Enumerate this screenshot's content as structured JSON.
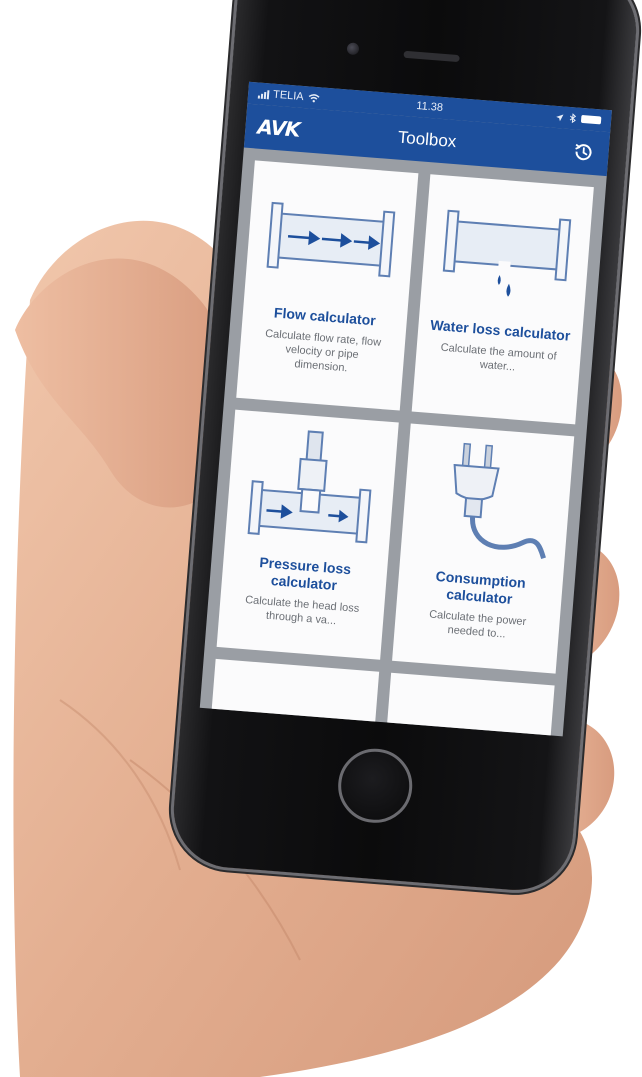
{
  "status_bar": {
    "carrier": "TELIA",
    "time": "11.38"
  },
  "header": {
    "logo": "AVK",
    "title": "Toolbox",
    "history_icon": "history-icon"
  },
  "tools": [
    {
      "title": "Flow calculator",
      "description": "Calculate flow rate, flow velocity or pipe dimension.",
      "icon": "pipe-flow-icon"
    },
    {
      "title": "Water loss calculator",
      "description": "Calculate the amount of water...",
      "icon": "pipe-leak-icon"
    },
    {
      "title": "Pressure loss calculator",
      "description": "Calculate the head loss through a va...",
      "icon": "valve-pressure-icon"
    },
    {
      "title": "Consumption calculator",
      "description": "Calculate the power needed to...",
      "icon": "power-plug-icon"
    }
  ],
  "colors": {
    "brand_blue": "#1d4f9c",
    "card_background": "#fbfbfc",
    "screen_background": "#9a9ea4"
  }
}
